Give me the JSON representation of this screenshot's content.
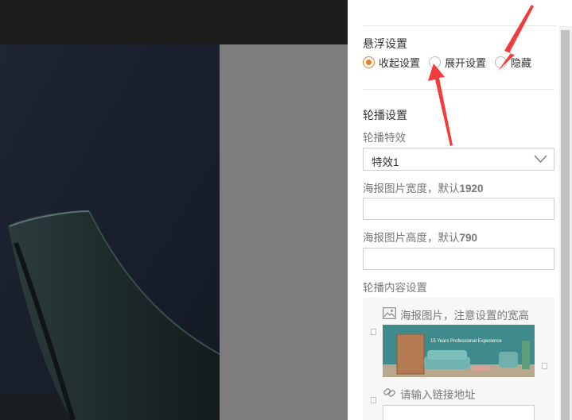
{
  "float_settings": {
    "title": "悬浮设置",
    "options": [
      {
        "label": "收起设置",
        "checked": true
      },
      {
        "label": "展开设置",
        "checked": false
      },
      {
        "label": "隐藏",
        "checked": false
      }
    ]
  },
  "carousel": {
    "title": "轮播设置",
    "effect_label": "轮播特效",
    "effect_value": "特效1",
    "width_label_prefix": "海报图片宽度，默认",
    "width_default": "1920",
    "width_value": "",
    "height_label_prefix": "海报图片高度，默认",
    "height_default": "790",
    "height_value": "",
    "content_label": "轮播内容设置",
    "poster_hint": "海报图片，注意设置的宽高",
    "link_hint": "请输入链接地址"
  },
  "colors": {
    "accent": "#f37b1d",
    "annotation_arrow": "#f23c3c"
  },
  "icons": {
    "dropdown": "chevron-down-icon",
    "poster": "image-icon",
    "link": "link-icon"
  }
}
